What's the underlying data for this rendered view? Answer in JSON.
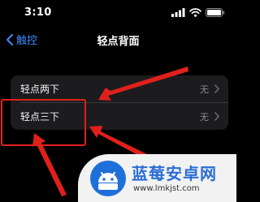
{
  "status_bar": {
    "time": "3:10"
  },
  "nav": {
    "back_label": "触控",
    "title": "轻点背面"
  },
  "settings": [
    {
      "label": "轻点两下",
      "value": "无"
    },
    {
      "label": "轻点三下",
      "value": "无"
    }
  ],
  "watermark": {
    "title": "蓝莓安卓网",
    "url": "www.lmkjst.com"
  },
  "colors": {
    "accent": "#3d8bff",
    "annotation": "#e0201a",
    "watermark_title": "#2b6fd6"
  },
  "icons": [
    "signal-icon",
    "wifi-icon",
    "battery-icon",
    "chevron-left-icon",
    "chevron-right-icon",
    "android-logo-icon"
  ]
}
